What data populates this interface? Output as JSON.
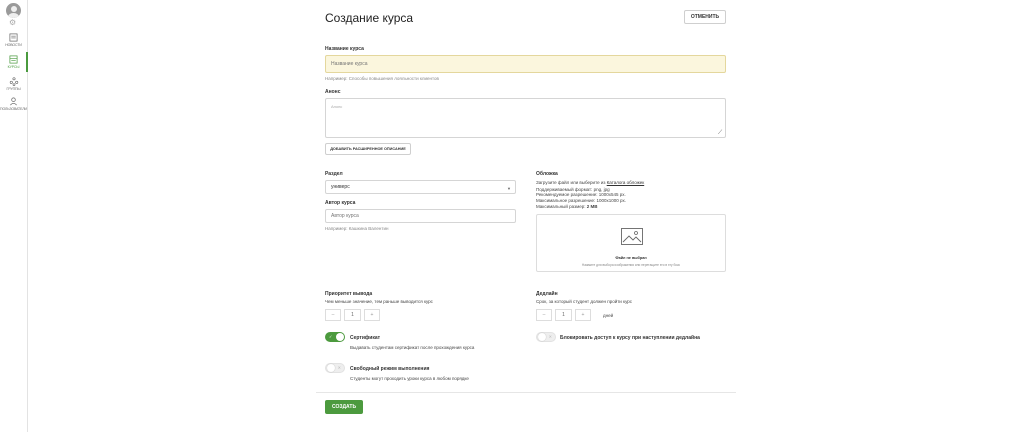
{
  "sidebar": {
    "items": [
      {
        "label": "НОВОСТИ",
        "icon": "news-icon"
      },
      {
        "label": "КУРСЫ",
        "icon": "courses-icon",
        "active": true
      },
      {
        "label": "ГРУППЫ",
        "icon": "groups-icon"
      },
      {
        "label": "ПОЛЬЗОВАТЕЛИ",
        "icon": "users-icon"
      }
    ]
  },
  "header": {
    "title": "Создание курса",
    "cancel_label": "ОТМЕНИТЬ"
  },
  "course_name": {
    "label": "Название курса",
    "placeholder": "Название курса",
    "hint": "Например: Способы повышения лояльности клиентов"
  },
  "announce": {
    "label": "Анонс",
    "placeholder": "Анонс"
  },
  "extended_desc_label": "ДОБАВИТЬ РАСШИРЕННОЕ ОПИСАНИЕ",
  "section": {
    "label": "Раздел",
    "value": "универс"
  },
  "author": {
    "label": "Автор курса",
    "placeholder": "Автор курса",
    "hint": "Например: Кашкина Валентин"
  },
  "cover": {
    "label": "Обложка",
    "intro_prefix": "Загрузите файл или выберите из ",
    "catalog_link": "Каталога обложек",
    "format_line": "Поддерживаемый формат: png, jpg",
    "recommended_line": "Рекомендуемое разрешение: 1000х545 px.",
    "min_line": "Максимальное разрешение: 1000х1000 px.",
    "max_size_prefix": "Максимальный размер: ",
    "max_size_value": "2 MB",
    "no_file": "Файл не выбран",
    "drop_hint": "Нажмите для выбора изображения или перетащите его в эту бокс"
  },
  "priority": {
    "label": "Приоритет вывода",
    "hint": "Чем меньше значение, тем раньше выводится курс",
    "minus": "–",
    "value": "1",
    "plus": "+"
  },
  "deadline": {
    "label": "Дедлайн",
    "hint": "Срок, за который студент должен пройти курс",
    "minus": "–",
    "value": "1",
    "plus": "+",
    "unit": "дней"
  },
  "certificate": {
    "label": "Сертификат",
    "hint": "Выдавать студентам сертификат после прохождения курса",
    "on": true
  },
  "block_access": {
    "label": "Блокировать доступ к курсу при наступлении дедлайна",
    "on": false
  },
  "free_mode": {
    "label": "Свободный режим выполнения",
    "hint": "Студенты могут проходить уроки курса в любом порядке",
    "on": false
  },
  "create_label": "СОЗДАТЬ",
  "colors": {
    "accent": "#4c9a3e",
    "focus_bg": "#fbf6dd"
  }
}
